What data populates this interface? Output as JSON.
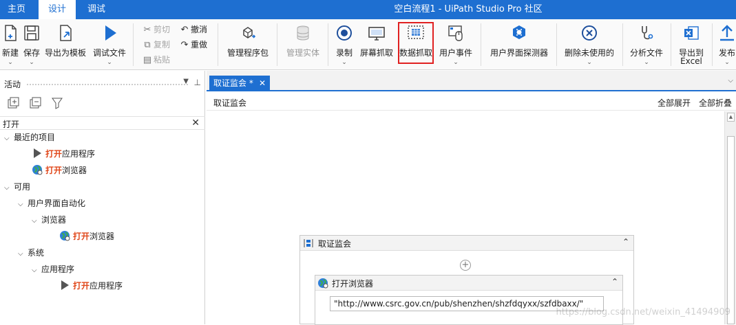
{
  "menu": {
    "tabs": [
      "主页",
      "设计",
      "调试"
    ],
    "active": 1
  },
  "window_title": "空白流程1 - UiPath Studio Pro 社区",
  "ribbon": {
    "new": "新建",
    "save": "保存",
    "export_template": "导出为模板",
    "debug_file": "调试文件",
    "cut": "剪切",
    "copy": "复制",
    "paste": "粘贴",
    "undo": "撤消",
    "redo": "重做",
    "manage_packages": "管理程序包",
    "manage_entities": "管理实体",
    "record": "录制",
    "screen_scraping": "屏幕抓取",
    "data_scraping": "数据抓取",
    "user_events": "用户事件",
    "ui_explorer": "用户界面探测器",
    "remove_unused": "删除未使用的",
    "analyze_file": "分析文件",
    "export_excel_1": "导出到",
    "export_excel_2": "Excel",
    "publish": "发布"
  },
  "activities_panel": {
    "title": "活动",
    "search_value": "打开",
    "tree": {
      "recent": "最近的项目",
      "recent_items": [
        {
          "hl": "打开",
          "rest": "应用程序",
          "icon": "play-triangle-icon"
        },
        {
          "hl": "打开",
          "rest": "浏览器",
          "icon": "globe-icon"
        }
      ],
      "available": "可用",
      "ui_automation": "用户界面自动化",
      "browser": "浏览器",
      "browser_item": {
        "hl": "打开",
        "rest": "浏览器"
      },
      "system": "系统",
      "application": "应用程序",
      "application_item": {
        "hl": "打开",
        "rest": "应用程序"
      }
    }
  },
  "document": {
    "tab": "取证监会 *",
    "breadcrumb": "取证监会",
    "expand_all": "全部展开",
    "collapse_all": "全部折叠",
    "sequence_title": "取证监会",
    "activity_title": "打开浏览器",
    "url_value": "\"http://www.csrc.gov.cn/pub/shenzhen/shzfdqyxx/szfdbaxx/\""
  },
  "watermark": "https://blog.csdn.net/weixin_41494909",
  "colors": {
    "accent": "#1e6fd1",
    "highlight_box": "#e02020",
    "match_text": "#e0471a"
  }
}
